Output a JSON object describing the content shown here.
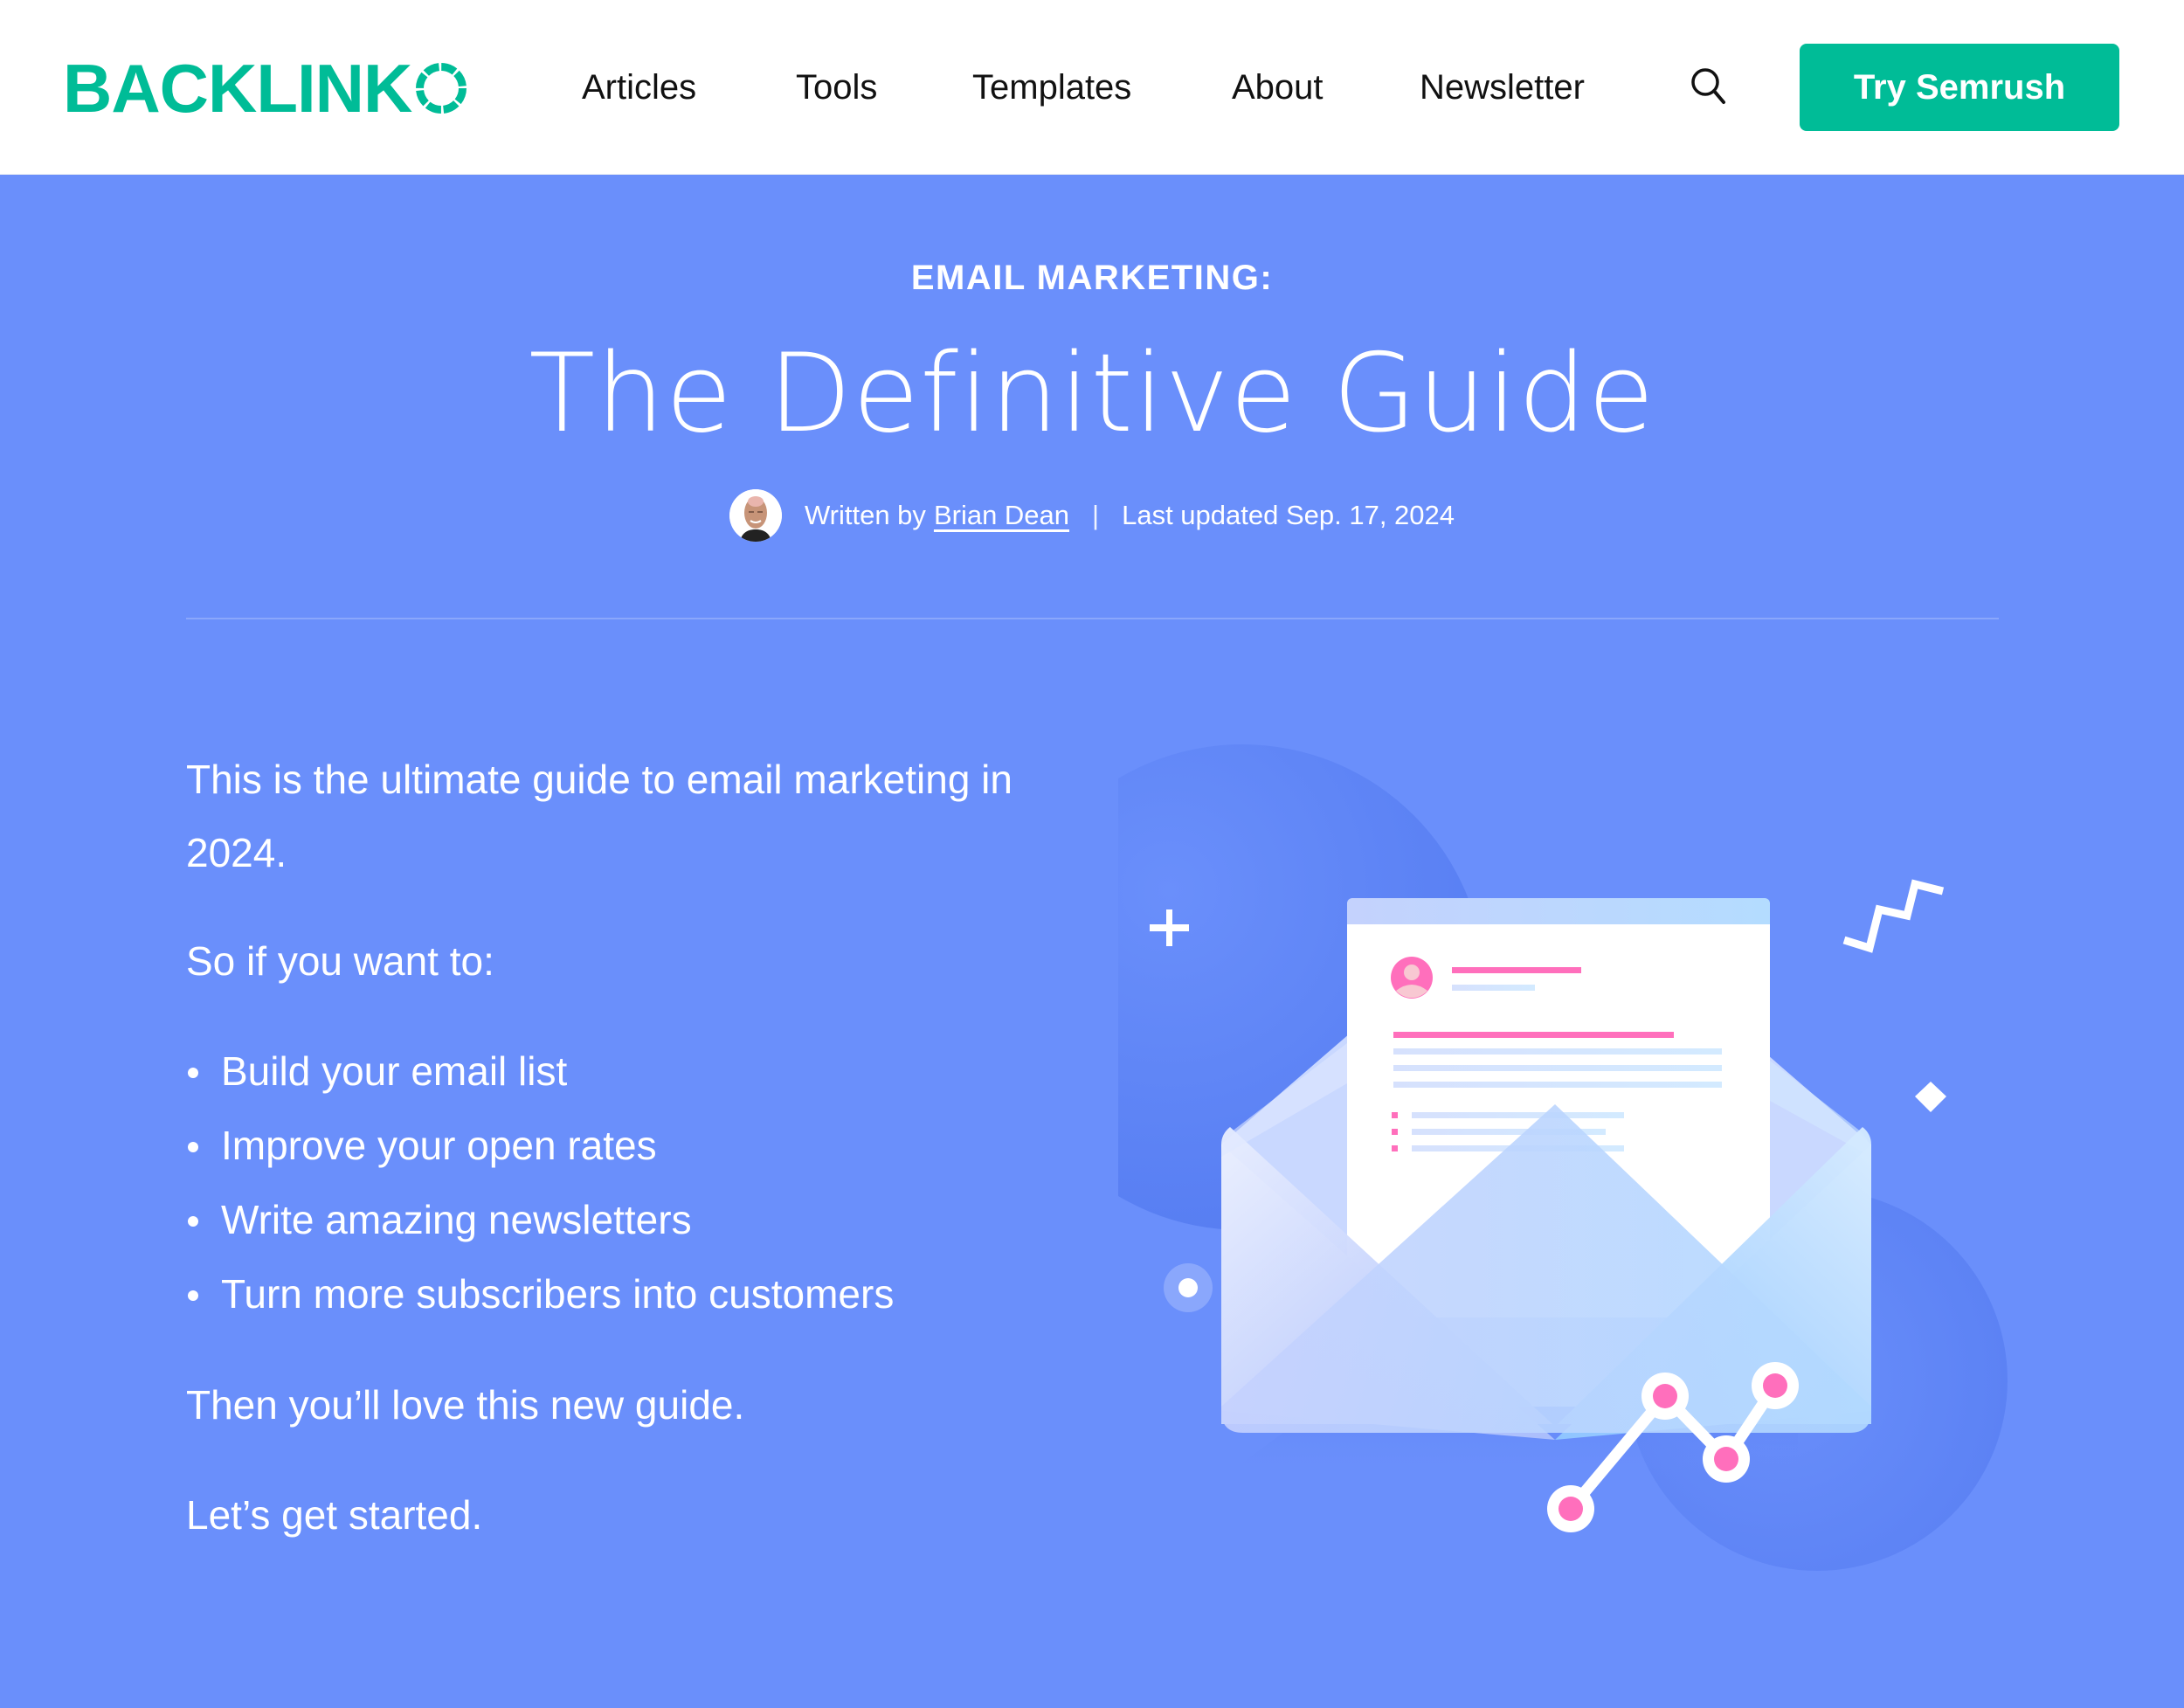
{
  "header": {
    "logo_text": "BACKLINK",
    "nav": [
      {
        "label": "Articles"
      },
      {
        "label": "Tools"
      },
      {
        "label": "Templates"
      },
      {
        "label": "About"
      },
      {
        "label": "Newsletter"
      }
    ],
    "search_icon": "search-icon",
    "cta_label": "Try Semrush"
  },
  "hero": {
    "eyebrow": "EMAIL MARKETING:",
    "title": "The Definitive Guide",
    "byline": {
      "written_by": "Written by",
      "author": "Brian Dean",
      "separator": "|",
      "updated": "Last updated Sep. 17, 2024"
    }
  },
  "intro": {
    "lead": "This is the ultimate guide to email marketing in 2024.",
    "prompt": "So if you want to:",
    "bullets": [
      "Build your email list",
      "Improve your open rates",
      "Write amazing newsletters",
      "Turn more subscribers into customers"
    ],
    "closing": "Then you’ll love this new guide.",
    "cta_text": "Let’s get started."
  },
  "colors": {
    "brand_green": "#00BC97",
    "hero_blue": "#6A8FFB",
    "accent_pink": "#FF6FBC"
  }
}
